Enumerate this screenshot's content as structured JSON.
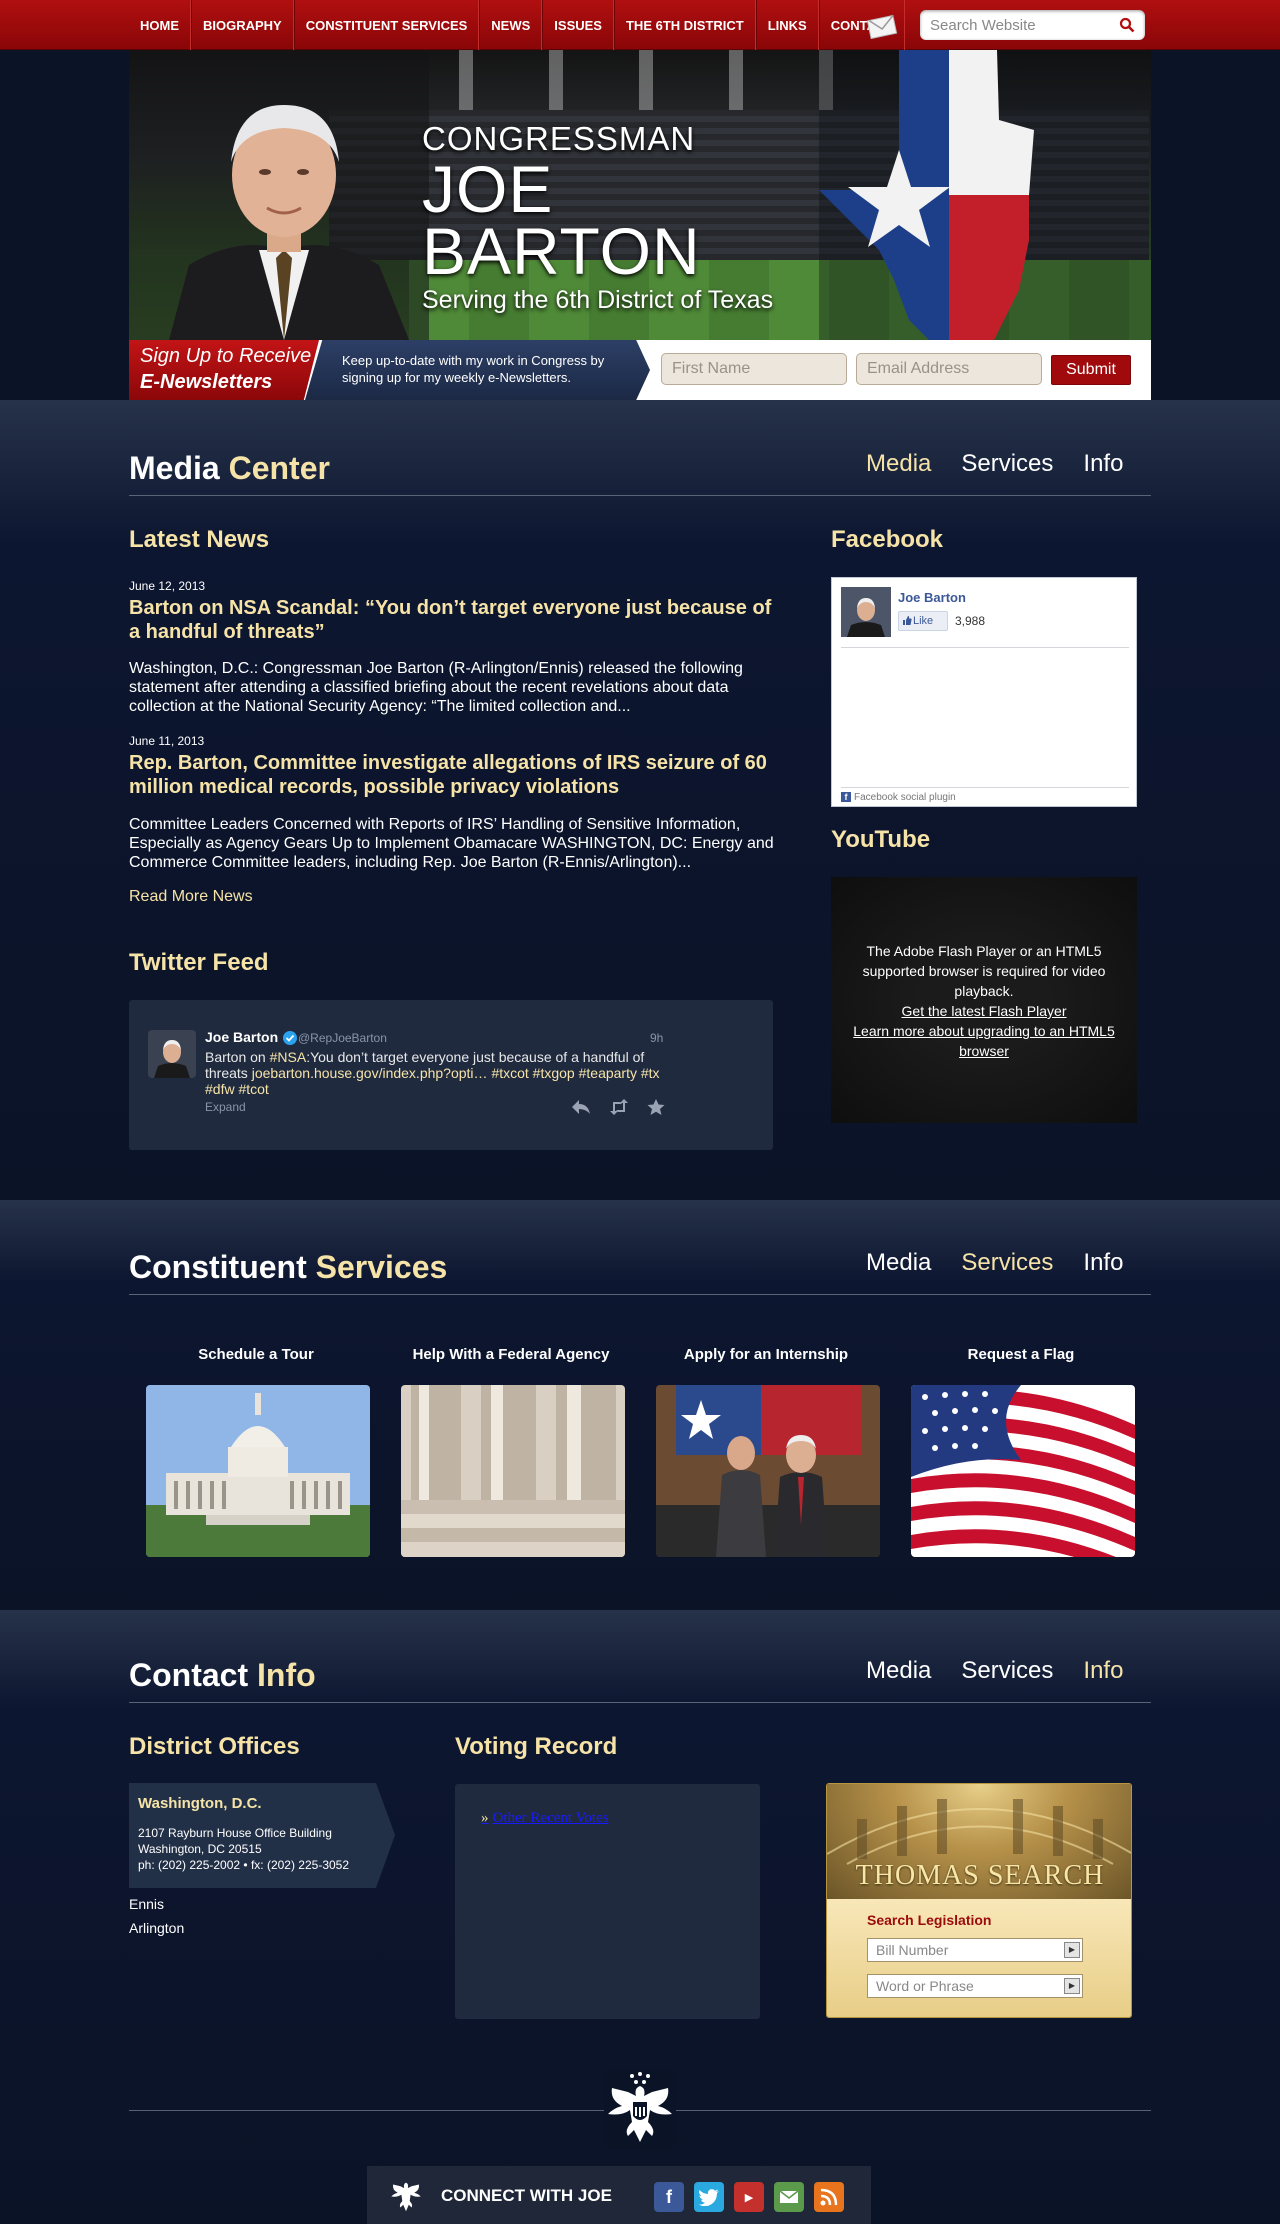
{
  "nav": {
    "items": [
      "HOME",
      "BIOGRAPHY",
      "CONSTITUENT SERVICES",
      "NEWS",
      "ISSUES",
      "THE 6TH DISTRICT",
      "LINKS",
      "CONTACT"
    ],
    "search_placeholder": "Search Website"
  },
  "banner": {
    "line1": "CONGRESSMAN",
    "line2": "JOE BARTON",
    "line3": "Serving the 6th District of Texas"
  },
  "newsletter": {
    "title1": "Sign Up to Receive",
    "title2": "E-Newsletters",
    "blurb": "Keep up-to-date with my work in Congress by signing up for my weekly e-Newsletters.",
    "first_name_placeholder": "First Name",
    "email_placeholder": "Email Address",
    "submit_label": "Submit"
  },
  "tabs": [
    "Media",
    "Services",
    "Info"
  ],
  "media": {
    "title_a": "Media",
    "title_b": "Center",
    "latest_news_heading": "Latest News",
    "news": [
      {
        "date": "June 12, 2013",
        "title": "Barton on NSA Scandal: “You don’t target everyone just because of a handful of threats”",
        "body": "Washington, D.C.: Congressman Joe Barton (R-Arlington/Ennis) released the following statement after attending a classified briefing about the recent revelations about data collection at the National Security Agency: “The limited collection and..."
      },
      {
        "date": "June 11, 2013",
        "title": "Rep. Barton, Committee investigate allegations of IRS seizure of 60 million medical records, possible privacy violations",
        "body": "Committee Leaders Concerned with Reports of IRS’ Handling of Sensitive Information, Especially as Agency Gears Up to Implement Obamacare WASHINGTON, DC: Energy and Commerce Committee leaders, including Rep. Joe Barton (R-Ennis/Arlington)..."
      }
    ],
    "read_more": "Read More News",
    "twitter_heading": "Twitter Feed",
    "tweet": {
      "name": "Joe Barton",
      "handle": "@RepJoeBarton",
      "time": "9h",
      "text_a": "Barton on ",
      "hashtag_nsa": "#NSA",
      "text_b": ":You don’t target everyone just because of a handful of threats ",
      "link": "joebarton.house.gov/index.php?opti…",
      "hashtags": "#txcot #txgop #teaparty #tx #dfw #tcot",
      "expand": "Expand"
    },
    "facebook_heading": "Facebook",
    "facebook": {
      "name": "Joe Barton",
      "like_label": "Like",
      "like_count": "3,988",
      "footer": "Facebook social plugin"
    },
    "youtube_heading": "YouTube",
    "youtube": {
      "message": "The Adobe Flash Player or an HTML5 supported browser is required for video playback.",
      "link1": "Get the latest Flash Player",
      "link2": "Learn more about upgrading to an HTML5 browser"
    }
  },
  "services": {
    "title_a": "Constituent",
    "title_b": "Services",
    "items": [
      "Schedule a Tour",
      "Help With a Federal Agency",
      "Apply for an Internship",
      "Request a Flag"
    ]
  },
  "contact": {
    "title_a": "Contact",
    "title_b": "Info",
    "district_heading": "District Offices",
    "dc": {
      "title": "Washington, D.C.",
      "line1": "2107 Rayburn House Office Building",
      "line2": "Washington, DC 20515",
      "line3": "ph: (202) 225-2002 • fx: (202) 225-3052"
    },
    "offices": [
      "Ennis",
      "Arlington"
    ],
    "voting_heading": "Voting Record",
    "voting_link": "Other Recent Votes",
    "thomas": {
      "title": "THOMAS SEARCH",
      "label": "Search Legislation",
      "bill_placeholder": "Bill Number",
      "word_placeholder": "Word or Phrase"
    }
  },
  "footer": {
    "connect_label": "CONNECT WITH JOE"
  },
  "colors": {
    "nav_red": "#a10a0c",
    "accent_gold": "#f6e3a8",
    "background_navy": "#0b1327"
  }
}
